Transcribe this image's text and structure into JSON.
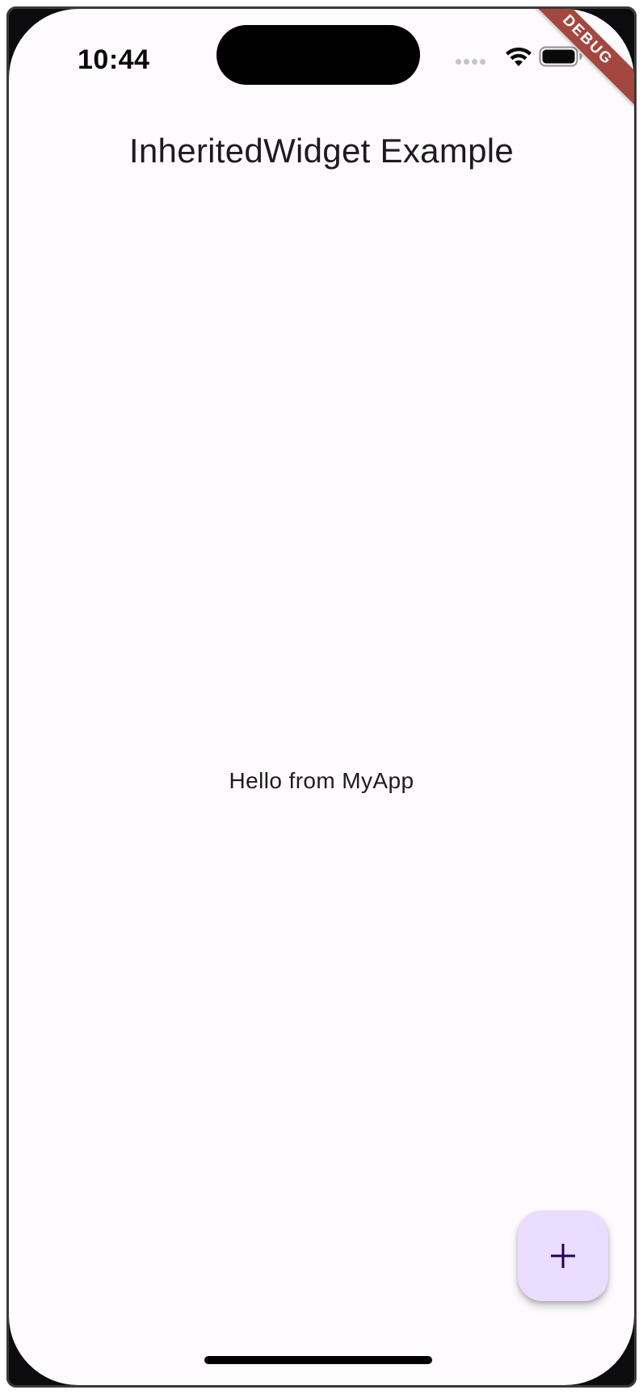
{
  "status_bar": {
    "time": "10:44",
    "icons": [
      "cellular-signal-icon",
      "wifi-icon",
      "battery-icon"
    ]
  },
  "debug_banner": {
    "label": "DEBUG",
    "color": "#a4473f"
  },
  "app_bar": {
    "title": "InheritedWidget Example"
  },
  "body": {
    "message": "Hello from MyApp"
  },
  "fab": {
    "icon": "add-icon",
    "background": "#eaddff",
    "icon_color": "#21005d"
  },
  "theme": {
    "background": "#fdfbfe",
    "text": "#1d1b20"
  }
}
